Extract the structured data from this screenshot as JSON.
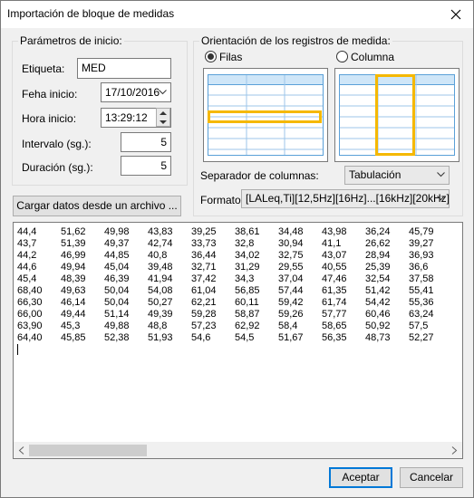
{
  "window": {
    "title": "Importación de bloque de medidas"
  },
  "params": {
    "group_label": "Parámetros de inicio:",
    "etiqueta_label": "Etiqueta:",
    "etiqueta_value": "MED",
    "fecha_label": "Feha inicio:",
    "fecha_value": "17/10/2016",
    "hora_label": "Hora inicio:",
    "hora_value": "13:29:12",
    "intervalo_label": "Intervalo (sg.):",
    "intervalo_value": "5",
    "duracion_label": "Duración (sg.):",
    "duracion_value": "5"
  },
  "orientation": {
    "group_label": "Orientación de los registros de medida:",
    "filas_label": "Filas",
    "columna_label": "Columna",
    "selected": "Filas",
    "separador_label": "Separador de columnas:",
    "separador_value": "Tabulación",
    "formato_label": "Formato:",
    "formato_value": "[LALeq,Ti][12,5Hz][16Hz]...[16kHz][20kHz]"
  },
  "buttons": {
    "cargar": "Cargar datos desde un archivo ...",
    "aceptar": "Aceptar",
    "cancelar": "Cancelar"
  },
  "data_rows": [
    [
      "44,4",
      "51,62",
      "49,98",
      "43,83",
      "39,25",
      "38,61",
      "34,48",
      "43,98",
      "36,24",
      "45,79"
    ],
    [
      "43,7",
      "51,39",
      "49,37",
      "42,74",
      "33,73",
      "32,8",
      "30,94",
      "41,1",
      "26,62",
      "39,27"
    ],
    [
      "44,2",
      "46,99",
      "44,85",
      "40,8",
      "36,44",
      "34,02",
      "32,75",
      "43,07",
      "28,94",
      "36,93"
    ],
    [
      "44,6",
      "49,94",
      "45,04",
      "39,48",
      "32,71",
      "31,29",
      "29,55",
      "40,55",
      "25,39",
      "36,6"
    ],
    [
      "45,4",
      "48,39",
      "46,39",
      "41,94",
      "37,42",
      "34,3",
      "37,04",
      "47,46",
      "32,54",
      "37,58"
    ],
    [
      "68,40",
      "49,63",
      "50,04",
      "54,08",
      "61,04",
      "56,85",
      "57,44",
      "61,35",
      "51,42",
      "55,41"
    ],
    [
      "66,30",
      "46,14",
      "50,04",
      "50,27",
      "62,21",
      "60,11",
      "59,42",
      "61,74",
      "54,42",
      "55,36"
    ],
    [
      "66,00",
      "49,44",
      "51,14",
      "49,39",
      "59,28",
      "58,87",
      "59,26",
      "57,77",
      "60,46",
      "63,24"
    ],
    [
      "63,90",
      "45,3",
      "49,88",
      "48,8",
      "57,23",
      "62,92",
      "58,4",
      "58,65",
      "50,92",
      "57,5"
    ],
    [
      "64,40",
      "45,85",
      "52,38",
      "51,93",
      "54,6",
      "54,5",
      "51,67",
      "56,35",
      "48,73",
      "52,27"
    ]
  ]
}
